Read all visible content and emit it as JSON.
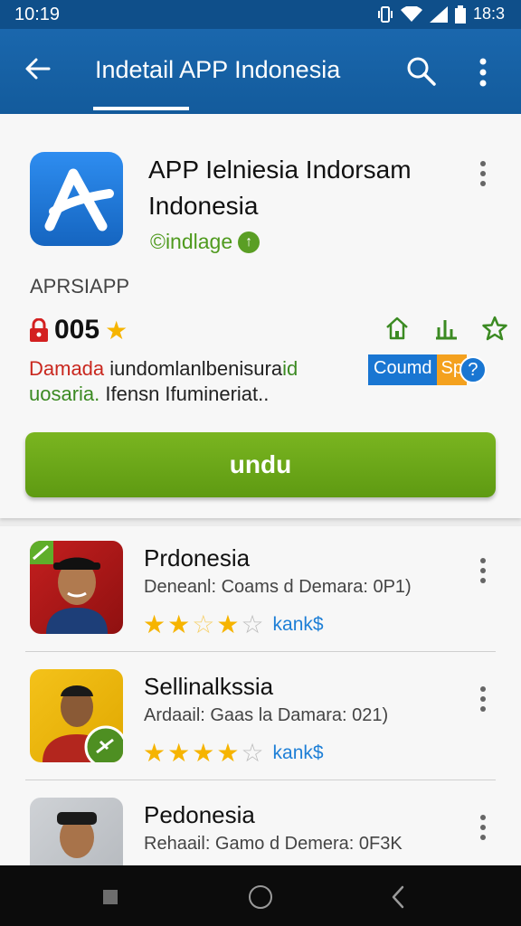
{
  "status": {
    "time": "10:19",
    "battery_time": "18:3"
  },
  "appbar": {
    "title": "Indetail APP Indonesia"
  },
  "app": {
    "name_line1": "APP Ielniesia Indorsam",
    "name_line2": "Indonesia",
    "developer": "©indlage",
    "developer_badge": "↑",
    "label": "APRSIAPP",
    "rating": "005",
    "desc_red": "Damada",
    "desc_dark1": " iundomlanlbenisura",
    "desc_green1": "id",
    "desc_green2": "uosaria.",
    "desc_dark2": " Ifensn Ifumineriat..",
    "chip_count": "Coumd",
    "chip_sp": "Sp",
    "chip_help": "?",
    "install_label": "undu"
  },
  "list": [
    {
      "name": "Prdonesia",
      "sub": "Deneanl: Coams d Demara: 0P1)",
      "stars": 3.5,
      "tag": "kank$"
    },
    {
      "name": "Sellinalkssia",
      "sub": "Ardaail: Gaas la Damara: 021)",
      "stars": 4.5,
      "tag": "kank$"
    },
    {
      "name": "Pedonesia",
      "sub": "Rehaail: Gamo d Demera: 0F3K"
    }
  ],
  "colors": {
    "appbar": "#1a67ad",
    "install": "#6aa819",
    "accent_blue": "#1976d2",
    "star": "#f6b400"
  }
}
